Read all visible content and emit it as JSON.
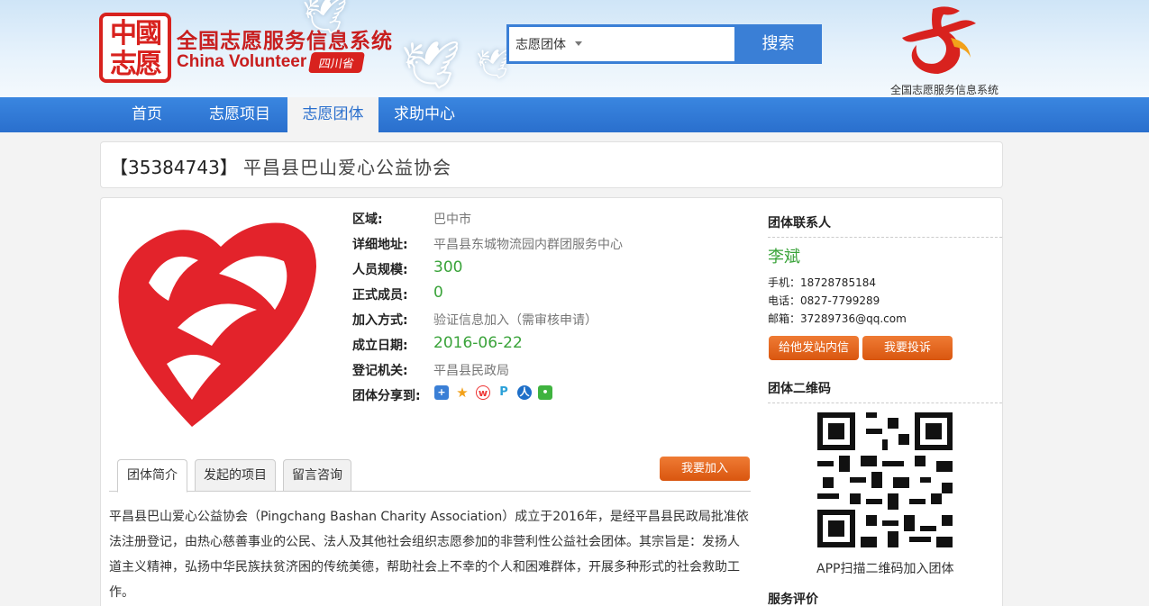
{
  "header": {
    "logo_seal": "中国\n志愿",
    "title": "全国志愿服务信息系统",
    "subtitle": "China Volunteer",
    "province": "四川省",
    "search": {
      "selected": "志愿团体",
      "button": "搜索"
    },
    "right_logo_caption": "全国志愿服务信息系统"
  },
  "nav": {
    "items": [
      {
        "label": "首页"
      },
      {
        "label": "志愿项目"
      },
      {
        "label": "志愿团体"
      },
      {
        "label": "求助中心"
      }
    ],
    "active_index": 2
  },
  "org": {
    "id": "【35384743】",
    "name": "平昌县巴山爱心公益协会",
    "fields": [
      {
        "label": "区域:",
        "value": "巴中市"
      },
      {
        "label": "详细地址:",
        "value": "平昌县东城物流园内群团服务中心"
      },
      {
        "label": "人员规模:",
        "value": "300"
      },
      {
        "label": "正式成员:",
        "value": "0"
      },
      {
        "label": "加入方式:",
        "value": "验证信息加入（需审核申请）"
      },
      {
        "label": "成立日期:",
        "value": "2016-06-22"
      },
      {
        "label": "登记机关:",
        "value": "平昌县民政局"
      }
    ],
    "share_label": "团体分享到:",
    "share_icons": [
      "qzone-icon",
      "favorite-icon",
      "weibo-icon",
      "pengyou-icon",
      "renren-icon",
      "wechat-icon"
    ]
  },
  "tabs": [
    {
      "label": "团体简介"
    },
    {
      "label": "发起的项目"
    },
    {
      "label": "留言咨询"
    }
  ],
  "join_button": "我要加入",
  "intro": "平昌县巴山爱心公益协会（Pingchang Bashan Charity Association）成立于2016年，是经平昌县民政局批准依法注册登记，由热心慈善事业的公民、法人及其他社会组织志愿参加的非营利性公益社会团体。其宗旨是：发扬人道主义精神，弘扬中华民族扶贫济困的传统美德，帮助社会上不幸的个人和困难群体，开展多种形式的社会救助工作。",
  "contact": {
    "heading": "团体联系人",
    "name": "李斌",
    "mobile": "手机：18728785184",
    "phone": "电话：0827-7799289",
    "email": "邮箱：37289736@qq.com",
    "message_button": "给他发站内信",
    "complain_button": "我要投诉"
  },
  "qr": {
    "heading": "团体二维码",
    "caption": "APP扫描二维码加入团体"
  },
  "rating_heading": "服务评价",
  "colors": {
    "brand_red": "#d8221e",
    "nav_blue": "#2a6fcd",
    "orange": "#e5681f",
    "green": "#3aa33a"
  }
}
